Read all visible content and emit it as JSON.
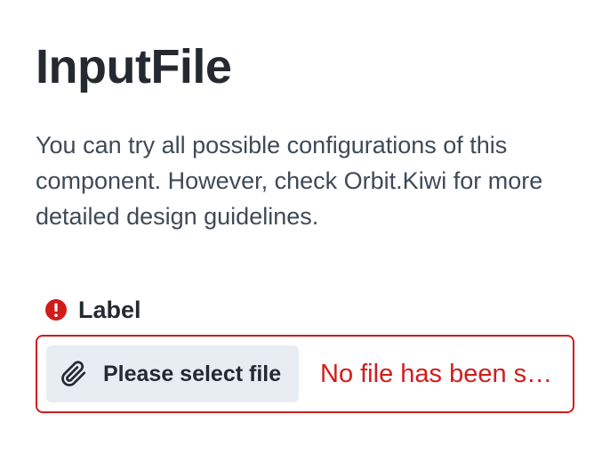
{
  "page": {
    "title": "InputFile",
    "description": "You can try all possible configurations of this component. However, check Orbit.Kiwi for more detailed design guidelines."
  },
  "input_file": {
    "label": "Label",
    "button_label": "Please select file",
    "status_text": "No file has been selected yet",
    "icons": {
      "error": "alert-circle-icon",
      "button": "paperclip-icon"
    },
    "colors": {
      "error": "#d21c1c",
      "button_background": "#e8edf1",
      "text": "#252a31"
    }
  }
}
